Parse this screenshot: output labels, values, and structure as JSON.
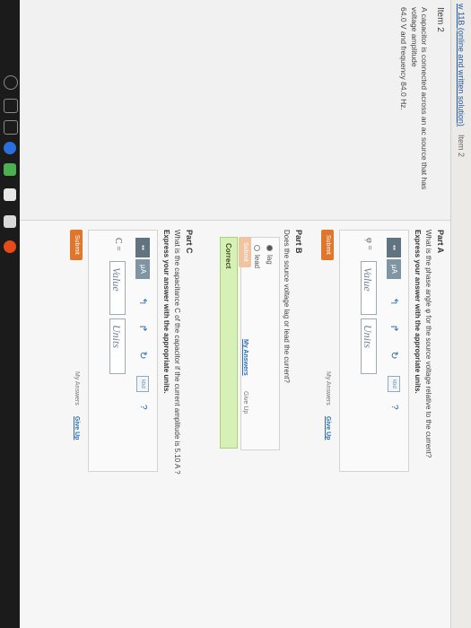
{
  "breadcrumb": "w 11B (online and written solution)",
  "tab": "Item 2",
  "problem": {
    "heading": "Item 2",
    "text_line1": "A capacitor is connected across an ac source that has voltage amplitude",
    "text_line2": "64.0 V and frequency 84.0 Hz."
  },
  "partA": {
    "title": "Part A",
    "question": "What is the phase angle φ for the source voltage relative to the current?",
    "instruction": "Express your answer with the appropriate units.",
    "var": "φ =",
    "value_placeholder": "Value",
    "units_placeholder": "Units",
    "submit": "Submit",
    "my_answers": "My Answers",
    "give_up": "Give Up"
  },
  "partB": {
    "title": "Part B",
    "question": "Does the source voltage lag or lead the current?",
    "options": [
      "lag",
      "lead"
    ],
    "selected": "lag",
    "submit": "Submit",
    "my_answers": "My Answers",
    "give_up": "Give Up",
    "result": "Correct"
  },
  "partC": {
    "title": "Part C",
    "question": "What is the capacitance C of the capacitor if the current amplitude is 5.10 A ?",
    "instruction": "Express your answer with the appropriate units.",
    "var": "C =",
    "value_placeholder": "Value",
    "units_placeholder": "Units",
    "submit": "Submit",
    "my_answers": "My Answers",
    "give_up": "Give Up"
  },
  "toolbar": {
    "templates": "▪▪",
    "mu": "μA",
    "undo": "↰",
    "redo": "↱",
    "reset": "↻",
    "keyboard": "kbd",
    "help": "?"
  },
  "colors": {
    "submit": "#e0762b",
    "link": "#2c6db0",
    "correct_bg": "#d7f0b6"
  }
}
